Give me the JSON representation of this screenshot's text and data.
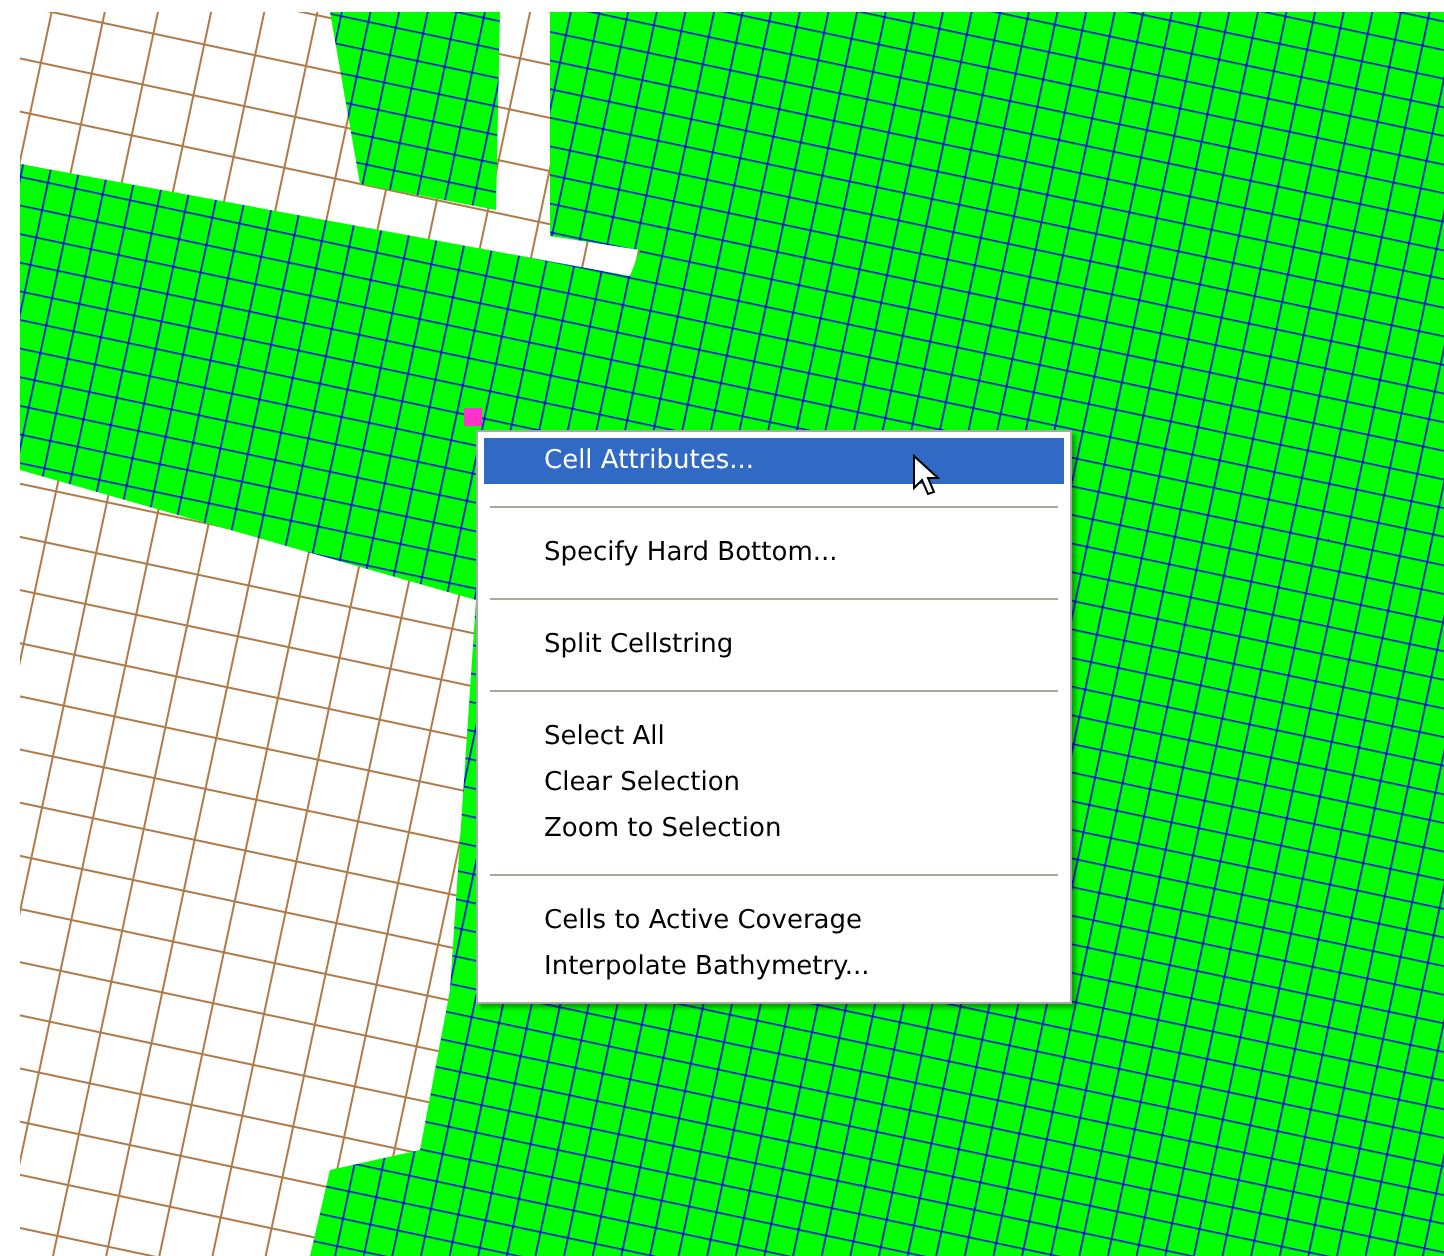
{
  "context_menu": {
    "groups": [
      [
        {
          "label": "Cell Attributes...",
          "selected": true
        }
      ],
      [
        {
          "label": "Specify Hard Bottom...",
          "selected": false
        }
      ],
      [
        {
          "label": "Split Cellstring",
          "selected": false
        }
      ],
      [
        {
          "label": "Select All",
          "selected": false
        },
        {
          "label": "Clear Selection",
          "selected": false
        },
        {
          "label": "Zoom to Selection",
          "selected": false
        }
      ],
      [
        {
          "label": "Cells to Active Coverage",
          "selected": false
        },
        {
          "label": "Interpolate Bathymetry...",
          "selected": false
        }
      ]
    ]
  }
}
